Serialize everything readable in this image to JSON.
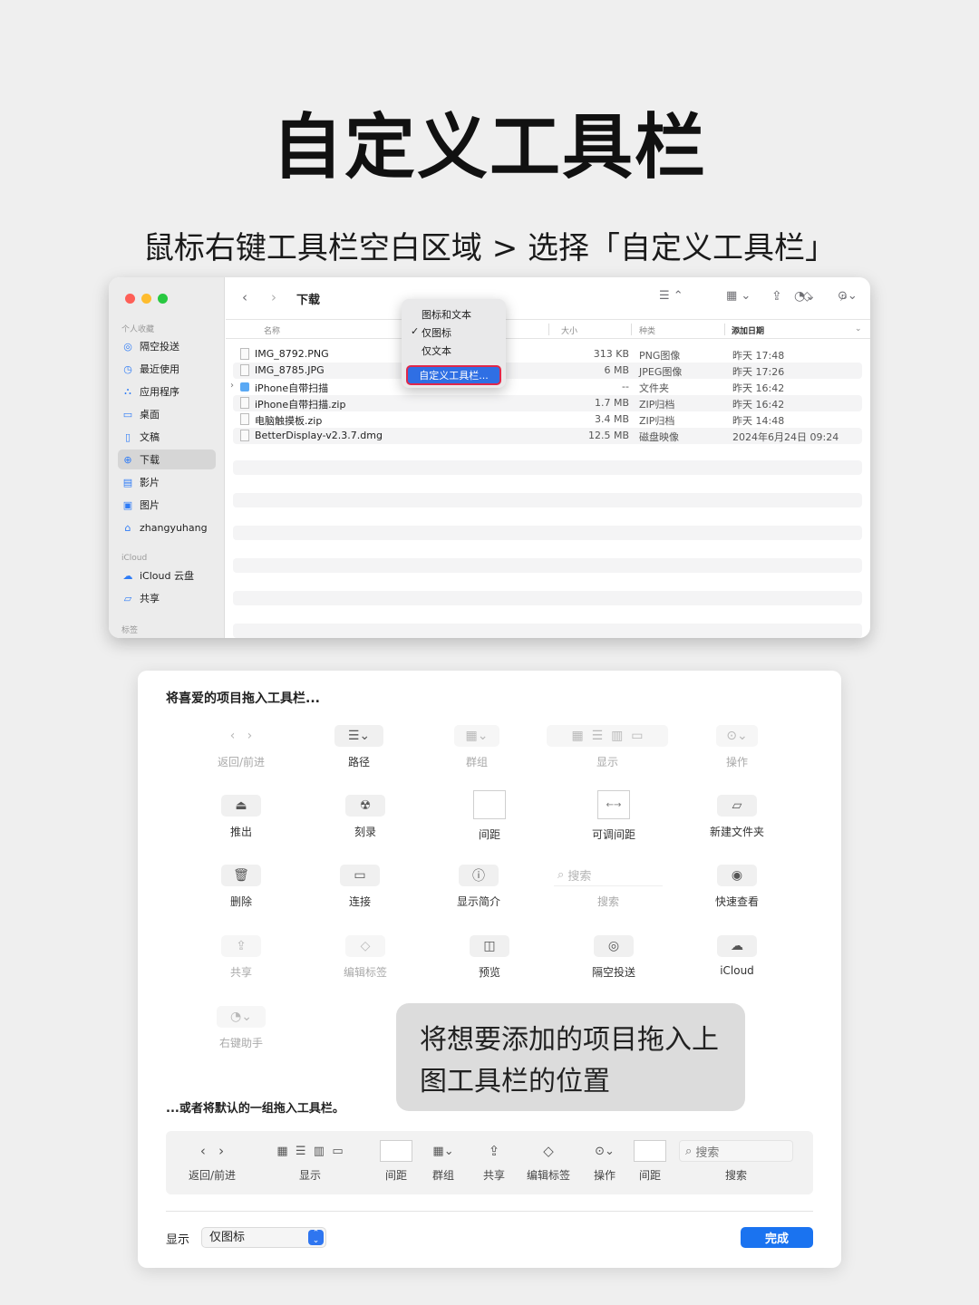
{
  "page": {
    "title": "自定义工具栏",
    "subtitle": "鼠标右键工具栏空白区域 > 选择「自定义工具栏」"
  },
  "finder": {
    "path_title": "下载",
    "sidebar": {
      "favorites_header": "个人收藏",
      "favorites": [
        {
          "label": "隔空投送",
          "icon": "airdrop-icon",
          "glyph": "◎"
        },
        {
          "label": "最近使用",
          "icon": "clock-icon",
          "glyph": "◷"
        },
        {
          "label": "应用程序",
          "icon": "apps-icon",
          "glyph": "⛬"
        },
        {
          "label": "桌面",
          "icon": "desktop-icon",
          "glyph": "▭"
        },
        {
          "label": "文稿",
          "icon": "document-icon",
          "glyph": "▯"
        },
        {
          "label": "下载",
          "icon": "download-icon",
          "glyph": "⊕"
        },
        {
          "label": "影片",
          "icon": "film-icon",
          "glyph": "▤"
        },
        {
          "label": "图片",
          "icon": "picture-icon",
          "glyph": "▣"
        },
        {
          "label": "zhangyuhang",
          "icon": "home-icon",
          "glyph": "⌂"
        }
      ],
      "icloud_header": "iCloud",
      "icloud": [
        {
          "label": "iCloud 云盘",
          "icon": "cloud-icon",
          "glyph": "☁"
        },
        {
          "label": "共享",
          "icon": "shared-folder-icon",
          "glyph": "▱"
        }
      ],
      "tags_header": "标签"
    },
    "columns": {
      "name": "名称",
      "size": "大小",
      "kind": "种类",
      "date": "添加日期"
    },
    "files": [
      {
        "name": "IMG_8792.PNG",
        "size": "313 KB",
        "kind": "PNG图像",
        "date": "昨天 17:48"
      },
      {
        "name": "IMG_8785.JPG",
        "size": "6 MB",
        "kind": "JPEG图像",
        "date": "昨天 17:26"
      },
      {
        "name": "iPhone自带扫描",
        "size": "--",
        "kind": "文件夹",
        "date": "昨天 16:42"
      },
      {
        "name": "iPhone自带扫描.zip",
        "size": "1.7 MB",
        "kind": "ZIP归档",
        "date": "昨天 16:42"
      },
      {
        "name": "电脑触摸板.zip",
        "size": "3.4 MB",
        "kind": "ZIP归档",
        "date": "昨天 14:48"
      },
      {
        "name": "BetterDisplay-v2.3.7.dmg",
        "size": "12.5 MB",
        "kind": "磁盘映像",
        "date": "2024年6月24日 09:24"
      }
    ],
    "context_menu": {
      "items": [
        "图标和文本",
        "仅图标",
        "仅文本"
      ],
      "checked": "✓",
      "highlighted": "自定义工具栏..."
    }
  },
  "customize": {
    "heading": "将喜爱的项目拖入工具栏...",
    "items": {
      "back_forward": "返回/前进",
      "path": "路径",
      "group": "群组",
      "view": "显示",
      "action": "操作",
      "eject": "推出",
      "burn": "刻录",
      "space": "间距",
      "flexible_space": "可调间距",
      "new_folder": "新建文件夹",
      "delete": "删除",
      "connect": "连接",
      "get_info": "显示简介",
      "search": "搜索",
      "search_placeholder": "搜索",
      "quick_look": "快速查看",
      "share": "共享",
      "edit_tags": "编辑标签",
      "preview": "预览",
      "airdrop": "隔空投送",
      "icloud": "iCloud",
      "right_click_helper": "右键助手"
    },
    "callout": "将想要添加的项目拖入上图工具栏的位置",
    "default_set_label": "...或者将默认的一组拖入工具栏。",
    "default_set": {
      "back_forward": "返回/前进",
      "view": "显示",
      "space1": "间距",
      "group": "群组",
      "share": "共享",
      "edit_tags": "编辑标签",
      "action": "操作",
      "space2": "间距",
      "search": "搜索",
      "search_placeholder": "搜索"
    },
    "show_label": "显示",
    "show_value": "仅图标",
    "done": "完成"
  },
  "colors": {
    "accent": "#1a73f0",
    "highlight_border": "#e0274a"
  }
}
